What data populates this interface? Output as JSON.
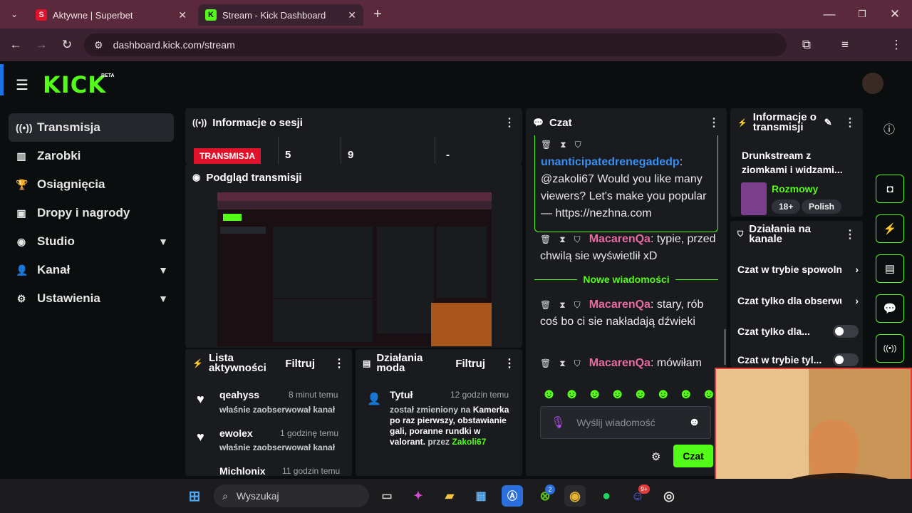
{
  "browser": {
    "tabs": [
      {
        "title": "Aktywne | Superbet",
        "fav": "S"
      },
      {
        "title": "Stream - Kick Dashboard",
        "fav": "K"
      }
    ],
    "url": "dashboard.kick.com/stream"
  },
  "logo": {
    "text": "KICK",
    "beta": "BETA"
  },
  "sidebar": {
    "items": [
      {
        "label": "Transmisja",
        "icon": "broadcast-icon"
      },
      {
        "label": "Zarobki",
        "icon": "chart-icon"
      },
      {
        "label": "Osiągnięcia",
        "icon": "trophy-icon"
      },
      {
        "label": "Dropy i nagrody",
        "icon": "gift-icon"
      },
      {
        "label": "Studio",
        "icon": "studio-icon"
      },
      {
        "label": "Kanał",
        "icon": "user-icon"
      },
      {
        "label": "Ustawienia",
        "icon": "gear-icon"
      }
    ]
  },
  "session": {
    "title": "Informacje o sesji",
    "status": "TRANSMISJA",
    "stat1": "5",
    "stat2": "9",
    "stat3": "-"
  },
  "preview": {
    "title": "Podgląd transmisji"
  },
  "activity": {
    "title": "Lista aktywności",
    "filter": "Filtruj",
    "items": [
      {
        "user": "qeahyss",
        "time": "8 minut temu",
        "action": "właśnie zaobserwował kanał"
      },
      {
        "user": "ewolex",
        "time": "1 godzinę temu",
        "action": "właśnie zaobserwował kanał"
      },
      {
        "user": "Michlonix",
        "time": "11 godzin temu",
        "action": ""
      }
    ]
  },
  "modactions": {
    "title": "Działania moda",
    "filter": "Filtruj",
    "item": {
      "label": "Tytuł",
      "time": "12 godzin temu",
      "text1": "został zmieniony na ",
      "highlight": "Kamerka po raz pierwszy, obstawianie gali, poranne rundki w valorant.",
      "by": " przez ",
      "author": "Zakoli67"
    }
  },
  "chat": {
    "title": "Czat",
    "messages": [
      {
        "user": "unanticipatedrenegadedp",
        "text": "@zakoli67 Would you like many viewers? Let's make you popular — https://nezhna.com"
      },
      {
        "user": "MacarenQa",
        "text": "typie, przed chwilą sie wyświetlił xD"
      },
      {
        "user": "MacarenQa",
        "text": "stary, rób coś bo ci sie nakładają dźwieki"
      },
      {
        "user": "MacarenQa",
        "text": "mówiłam"
      }
    ],
    "divider": "Nowe wiadomości",
    "input_placeholder": "Wyślij wiadomość",
    "send": "Czat"
  },
  "streaminfo": {
    "title": "Informacje o transmisji",
    "stream_title": "Drunkstream z ziomkami i widzami...",
    "category": "Rozmowy",
    "tags": [
      "18+",
      "Polish"
    ]
  },
  "channelactions": {
    "title": "Działania na kanale",
    "items": [
      "Czat w trybie spowolnionym",
      "Czat tylko dla obserwujących",
      "Czat tylko dla...",
      "Czat w trybie tyl..."
    ]
  },
  "taskbar": {
    "search": "Wyszukaj",
    "xbox_badge": "2",
    "discord_badge": "9+"
  }
}
